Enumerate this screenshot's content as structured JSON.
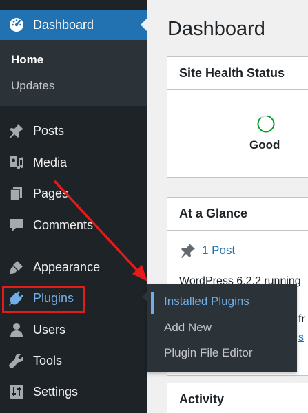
{
  "sidebar": {
    "dashboard": {
      "label": "Dashboard",
      "icon": "dashboard-icon"
    },
    "submenu": {
      "home": "Home",
      "updates": "Updates"
    },
    "items": [
      {
        "label": "Posts",
        "icon": "pushpin-icon"
      },
      {
        "label": "Media",
        "icon": "media-icon"
      },
      {
        "label": "Pages",
        "icon": "pages-icon"
      },
      {
        "label": "Comments",
        "icon": "comment-icon"
      },
      {
        "label": "Appearance",
        "icon": "paintbrush-icon"
      },
      {
        "label": "Plugins",
        "icon": "plugin-icon"
      },
      {
        "label": "Users",
        "icon": "user-icon"
      },
      {
        "label": "Tools",
        "icon": "wrench-icon"
      },
      {
        "label": "Settings",
        "icon": "settings-icon"
      }
    ]
  },
  "flyout": {
    "items": [
      "Installed Plugins",
      "Add New",
      "Plugin File Editor"
    ]
  },
  "main": {
    "title": "Dashboard",
    "site_health": {
      "title": "Site Health Status",
      "status": "Good"
    },
    "glance": {
      "title": "At a Glance",
      "posts": "1 Post",
      "version_text": "WordPress 6.2.2 running",
      "partial_1": "fr",
      "partial_2": "s"
    },
    "activity": {
      "title": "Activity"
    }
  },
  "colors": {
    "sidebar_bg": "#1d2327",
    "submenu_bg": "#2c3338",
    "accent": "#2271b1",
    "highlight": "#72aee6",
    "annotation_red": "#e21b1b",
    "health_green": "#00a32a"
  }
}
